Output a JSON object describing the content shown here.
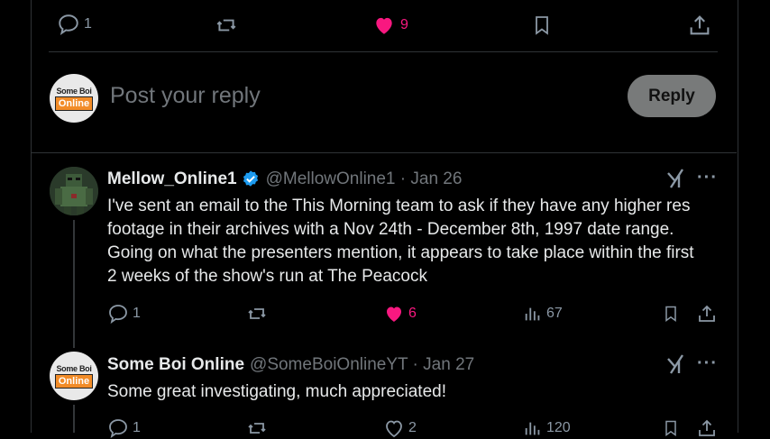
{
  "top_actions": {
    "replies": "1",
    "likes": "9"
  },
  "composer": {
    "placeholder": "Post your reply",
    "button": "Reply"
  },
  "avatar_sbo": {
    "top": "Some Boi",
    "box": "Online"
  },
  "tweets": [
    {
      "name": "Mellow_Online1",
      "handle": "@MellowOnline1 · Jan 26",
      "text": "I've sent an email to the This Morning team to ask if they have any higher res footage in their archives with a Nov 24th - December 8th, 1997 date range. Going on what the presenters mention, it appears to take place within the first 2 weeks of the show's run at The Peacock",
      "replies": "1",
      "likes": "6",
      "views": "67"
    },
    {
      "name": "Some Boi Online",
      "handle": "@SomeBoiOnlineYT · Jan 27",
      "text": "Some great investigating, much appreciated!",
      "replies": "1",
      "likes": "2",
      "views": "120"
    }
  ],
  "colors": {
    "like_active": "#f91880",
    "verified": "#1d9bf0",
    "muted": "#71767b"
  }
}
